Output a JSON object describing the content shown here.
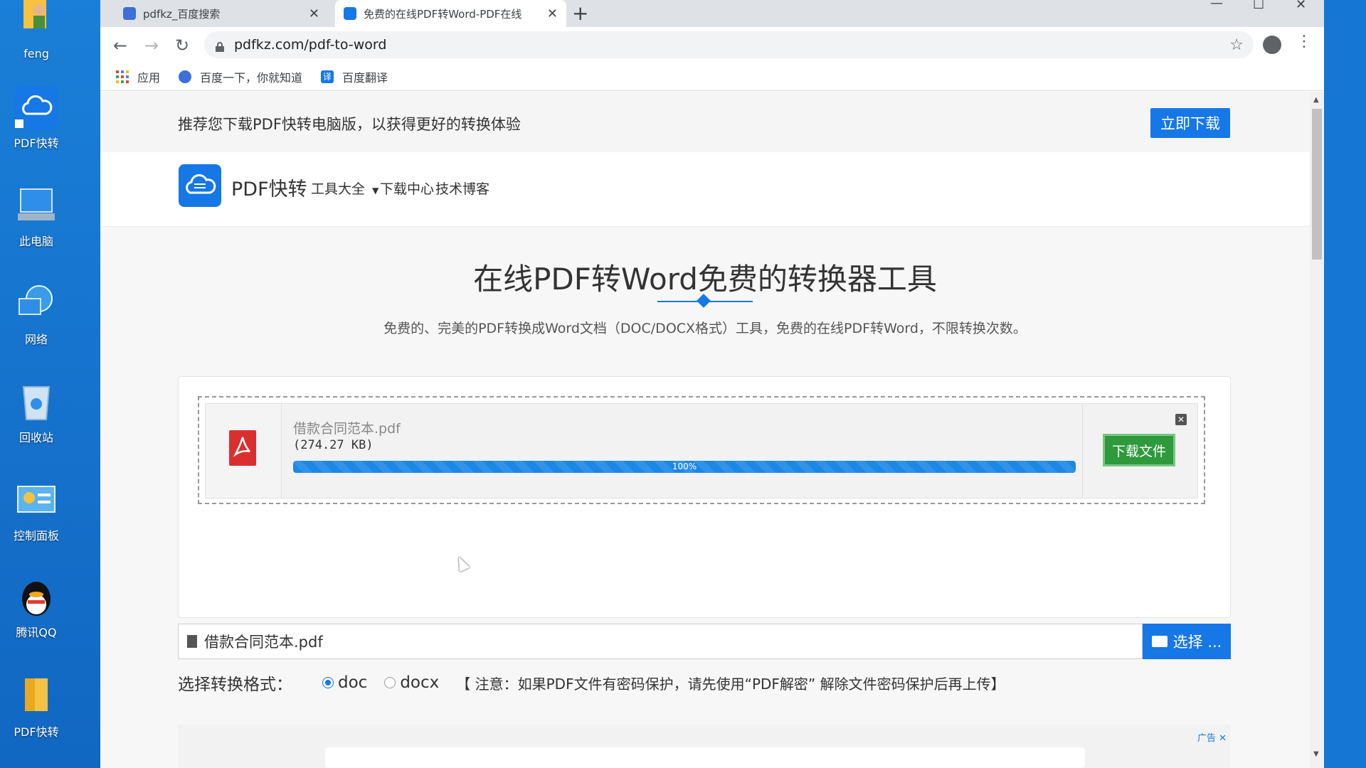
{
  "desktop": {
    "icons": [
      {
        "label": "feng",
        "icon": "user-folder-icon"
      },
      {
        "label": "PDF快转",
        "icon": "pdf-app-icon"
      },
      {
        "label": "此电脑",
        "icon": "computer-icon"
      },
      {
        "label": "网络",
        "icon": "network-icon"
      },
      {
        "label": "回收站",
        "icon": "recycle-bin-icon"
      },
      {
        "label": "控制面板",
        "icon": "control-panel-icon"
      },
      {
        "label": "腾讯QQ",
        "icon": "qq-icon"
      },
      {
        "label": "PDF快转",
        "icon": "folder-icon"
      }
    ]
  },
  "browser": {
    "tabs": [
      {
        "title": "pdfkz_百度搜索",
        "active": false
      },
      {
        "title": "免费的在线PDF转Word-PDF在线",
        "active": true
      }
    ],
    "url": "pdfkz.com/pdf-to-word",
    "bookmarks": [
      {
        "label": "应用",
        "icon": "apps-grid-icon"
      },
      {
        "label": "百度一下，你就知道",
        "icon": "baidu-paw-icon"
      },
      {
        "label": "百度翻译",
        "icon": "translate-icon"
      }
    ]
  },
  "promo": {
    "text": "推荐您下载PDF快转电脑版，以获得更好的转换体验",
    "button": "立即下载"
  },
  "site_header": {
    "logo_text": "PDF快转",
    "nav": [
      "工具大全",
      "下载中心",
      "技术博客"
    ]
  },
  "hero": {
    "title": "在线PDF转Word免费的转换器工具",
    "subtitle": "免费的、完美的PDF转换成Word文档（DOC/DOCX格式）工具，免费的在线PDF转Word，不限转换次数。"
  },
  "upload": {
    "file_name": "借款合同范本.pdf",
    "file_size": "(274.27 KB)",
    "progress": 100,
    "progress_label": "100%",
    "download_button": "下载文件"
  },
  "file_input": {
    "value": "借款合同范本.pdf",
    "choose_button": "选择 ..."
  },
  "format": {
    "label": "选择转换格式：",
    "options": [
      "doc",
      "docx"
    ],
    "selected": "doc",
    "note": "【 注意：如果PDF文件有密码保护，请先使用“PDF解密” 解除文件密码保护后再上传】"
  },
  "ad": {
    "label": "广告"
  },
  "colors": {
    "primary": "#1677e6",
    "download_green": "#2e9a3c",
    "pdf_red": "#d9302f"
  }
}
